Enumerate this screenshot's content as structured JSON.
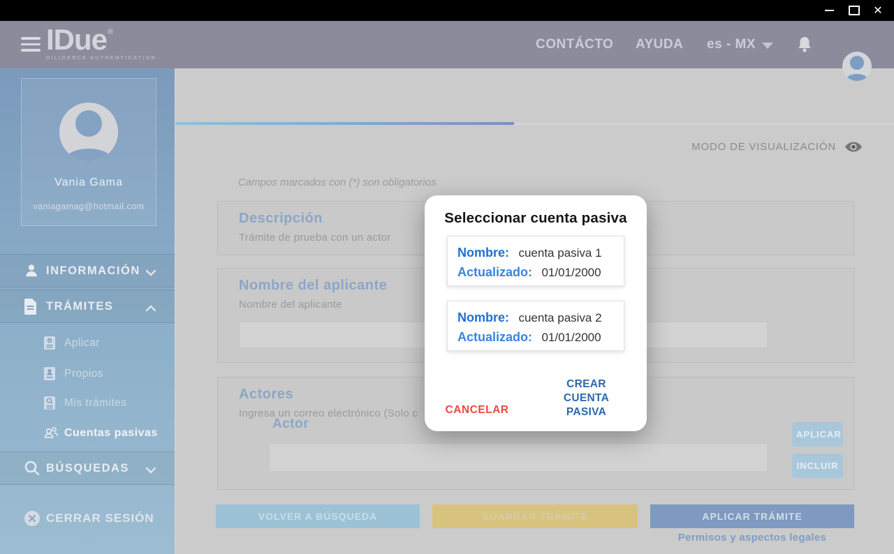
{
  "header": {
    "logo_title": "IDue",
    "logo_mark": "®",
    "logo_subtitle": "DILIGENCE AUTHENTICATION",
    "nav_contact": "CONTÁCTO",
    "nav_help": "AYUDA",
    "language": "es - MX"
  },
  "sidebar": {
    "profile": {
      "name": "Vania Gama",
      "email": "vaniagamag@hotmail.com"
    },
    "informacion": "INFORMACIÓN",
    "tramites": "TRÁMITES",
    "submenu": {
      "aplicar": "Aplicar",
      "propios": "Propios",
      "mis_tramites": "Mis trámites",
      "cuentas_pasivas": "Cuentas pasivas"
    },
    "busquedas": "BÚSQUEDAS",
    "cerrar_sesion": "CERRAR SESIÓN"
  },
  "main": {
    "view_mode": "MODO DE VISUALIZACIÓN",
    "required_note": "Campos marcados con (*) son obligatorios",
    "descripcion": {
      "title": "Descripción",
      "subtitle": "Trámite de prueba con un actor"
    },
    "aplicante": {
      "title": "Nombre del aplicante",
      "label": "Nombre del aplicante",
      "value": ""
    },
    "actores": {
      "title": "Actores",
      "subtitle": "Ingresa un correo electrónico (Solo c",
      "actor_label": "Actor",
      "actor_value": "",
      "btn_aplicar": "APLICAR",
      "btn_incluir": "INCLUIR"
    },
    "btn_volver": "VOLVER A BÚSQUEDA",
    "btn_guardar": "GUARDAR TRÁMITE",
    "btn_aplicar_tramite": "APLICAR TRÁMITE",
    "legal_link": "Permisos y aspectos legales"
  },
  "modal": {
    "title": "Seleccionar cuenta pasiva",
    "accounts": [
      {
        "name_label": "Nombre:",
        "name": "cuenta pasiva 1",
        "updated_label": "Actualizado:",
        "updated": "01/01/2000"
      },
      {
        "name_label": "Nombre:",
        "name": "cuenta pasiva 2",
        "updated_label": "Actualizado:",
        "updated": "01/01/2000"
      }
    ],
    "btn_cancel": "CANCELAR",
    "btn_create": "CREAR CUENTA PASIVA"
  },
  "colors": {
    "titlebar_bg": "#000000",
    "header_bg": "#8b8b9c",
    "sidebar_blue": "#7b9abc",
    "section_heading_blue": "#8ba6c8",
    "modal_label_blue": "#1d71d2",
    "modal_label_blue_alt": "#3a83de",
    "cancel_red": "#e84b3f",
    "create_blue": "#2b67b0",
    "btn_volver_bg": "#9cc2d6",
    "btn_guardar_bg": "#d8c37e",
    "btn_aplicar_bg": "#7e9ac0",
    "legal_link_blue": "#7f9cc6"
  }
}
